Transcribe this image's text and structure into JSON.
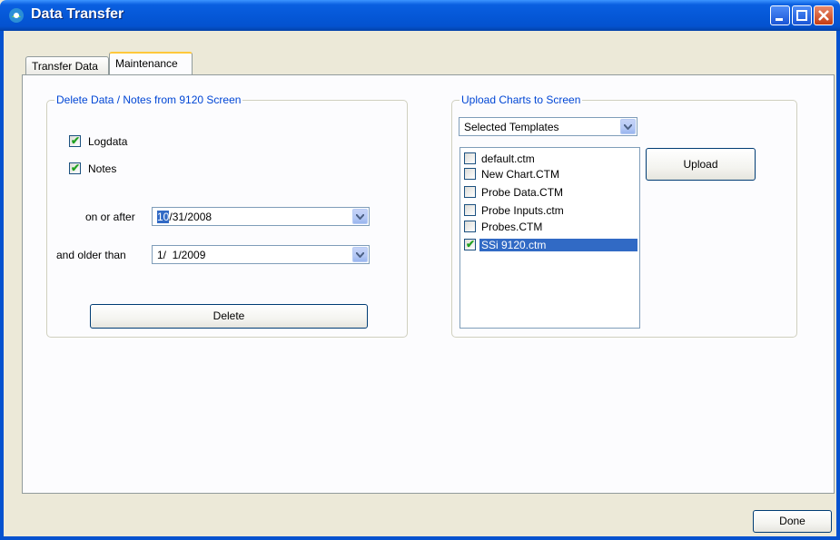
{
  "window": {
    "title": "Data Transfer",
    "app_icon": "satellite-icon"
  },
  "tabs": [
    {
      "label": "Transfer Data",
      "active": false
    },
    {
      "label": "Maintenance",
      "active": true
    }
  ],
  "delete_group": {
    "legend": "Delete Data / Notes from 9120 Screen",
    "logdata": {
      "label": "Logdata",
      "checked": true
    },
    "notes": {
      "label": "Notes",
      "checked": true
    },
    "on_or_after": {
      "label": "on or after",
      "value_selected": "10",
      "value_rest": "/31/2008"
    },
    "older_than": {
      "label": "and older than",
      "value": "1/  1/2009"
    },
    "delete_button": "Delete"
  },
  "upload_group": {
    "legend": "Upload Charts to Screen",
    "template_select": "Selected Templates",
    "files": [
      {
        "name": "default.ctm",
        "checked": false,
        "selected": false
      },
      {
        "name": "New Chart.CTM",
        "checked": false,
        "selected": false
      },
      {
        "name": "Probe Data.CTM",
        "checked": false,
        "selected": false
      },
      {
        "name": "Probe Inputs.ctm",
        "checked": false,
        "selected": false
      },
      {
        "name": "Probes.CTM",
        "checked": false,
        "selected": false
      },
      {
        "name": "SSi 9120.ctm",
        "checked": true,
        "selected": true
      }
    ],
    "upload_button": "Upload"
  },
  "footer": {
    "done_button": "Done"
  },
  "colors": {
    "titlebar": "#0452cf",
    "legend": "#0046d5",
    "selection": "#316ac5",
    "tab_highlight": "#ffc83c"
  }
}
